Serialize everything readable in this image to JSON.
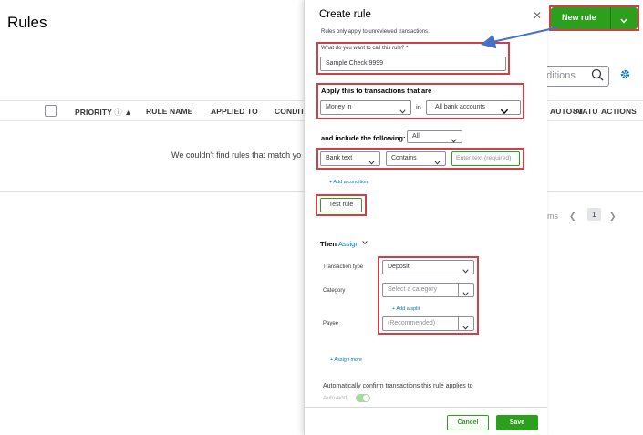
{
  "page": {
    "title": "Rules",
    "search_placeholder": "nditions",
    "columns": [
      "PRIORITY",
      "RULE NAME",
      "APPLIED TO",
      "CONDIT",
      "AUTO-AI",
      "STATU",
      "ACTIONS"
    ],
    "empty_message": "We couldn't find rules that match yo",
    "pager_label": "ms",
    "current_page": "1",
    "new_rule_label": "New rule"
  },
  "drawer": {
    "title": "Create rule",
    "subtitle": "Rules only apply to unreviewed transactions.",
    "name_label": "What do you want to call this rule? *",
    "name_value": "Sample Check 9999",
    "apply_label": "Apply this to transactions that are",
    "direction_value": "Money in",
    "in_label": "in",
    "accounts_value": "All bank accounts",
    "include_label": "and include the following:",
    "include_value": "All",
    "condition_field": "Bank text",
    "condition_operator": "Contains",
    "condition_text_placeholder": "Enter text (required)",
    "add_condition_link": "+ Add a condition",
    "test_rule_label": "Test rule",
    "then_label": "Then",
    "assign_label": "Assign",
    "transaction_type_label": "Transaction type",
    "transaction_type_value": "Deposit",
    "category_label": "Category",
    "category_placeholder": "Select a category",
    "add_split_link": "+ Add a split",
    "payee_label": "Payee",
    "payee_value": "(Recommended)",
    "assign_more_link": "+ Assign more",
    "auto_confirm_label": "Automatically confirm transactions this rule applies to",
    "auto_add_label": "Auto-add",
    "auto_add_on": true,
    "cancel_label": "Cancel",
    "save_label": "Save"
  },
  "colors": {
    "primary_green": "#2ca01c",
    "link_blue": "#0077c5",
    "highlight_red": "#d33f46",
    "arrow_blue": "#4472c4"
  }
}
